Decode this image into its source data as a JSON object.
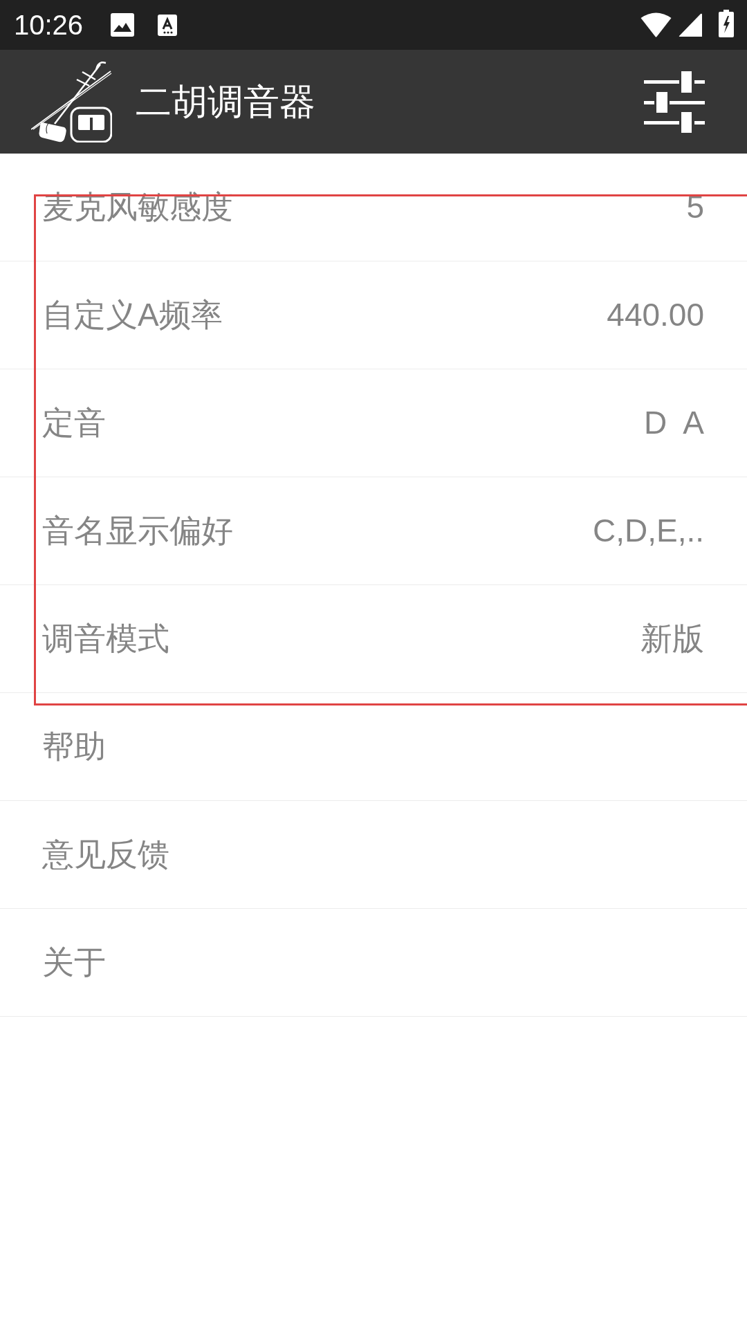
{
  "status_bar": {
    "time": "10:26"
  },
  "toolbar": {
    "title": "二胡调音器"
  },
  "settings": [
    {
      "label": "麦克风敏感度",
      "value": "5"
    },
    {
      "label": "自定义A频率",
      "value": "440.00"
    },
    {
      "label": "定音",
      "value": "D  A"
    },
    {
      "label": "音名显示偏好",
      "value": "C,D,E,.."
    },
    {
      "label": "调音模式",
      "value": "新版"
    },
    {
      "label": "帮助"
    },
    {
      "label": "意见反馈"
    },
    {
      "label": "关于"
    }
  ]
}
